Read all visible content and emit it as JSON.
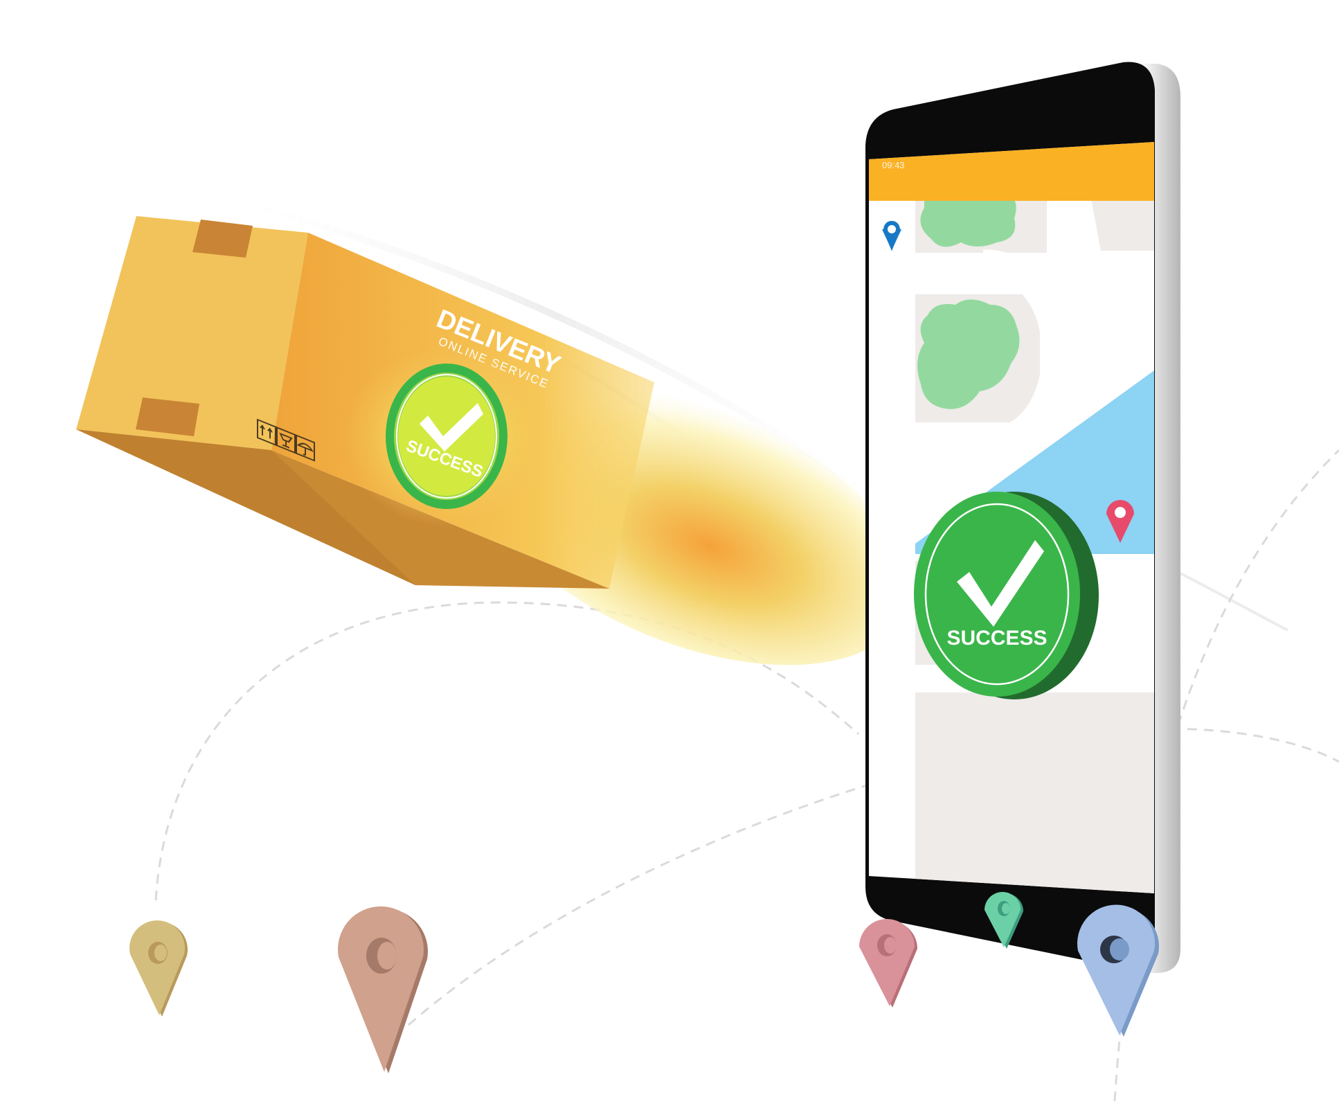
{
  "package": {
    "title": "DELIVERY",
    "subtitle": "ONLINE SERVICE",
    "badge_label": "SUCCESS"
  },
  "phone": {
    "status_time": "09:43",
    "badge_label": "SUCCESS"
  },
  "colors": {
    "status_bar": "#FBB124",
    "success_green": "#3AB54A",
    "success_green_dark": "#226B2E",
    "map_park": "#93D99F",
    "map_water": "#8CD3F4",
    "map_block": "#EEEBE9",
    "box_side": "#F2C35A",
    "box_front": "#F0A63A"
  },
  "icons": {
    "status": [
      "signal-icon",
      "wifi-icon",
      "battery-icon"
    ],
    "map_pins": [
      "map-pin-blue-icon",
      "map-pin-red-icon"
    ],
    "ground_pins": [
      "pin-tan-icon",
      "pin-brown-icon",
      "pin-pink-icon",
      "pin-teal-icon",
      "pin-blue-icon"
    ],
    "handling": [
      "this-way-up-icon",
      "fragile-icon",
      "keep-dry-icon"
    ]
  }
}
